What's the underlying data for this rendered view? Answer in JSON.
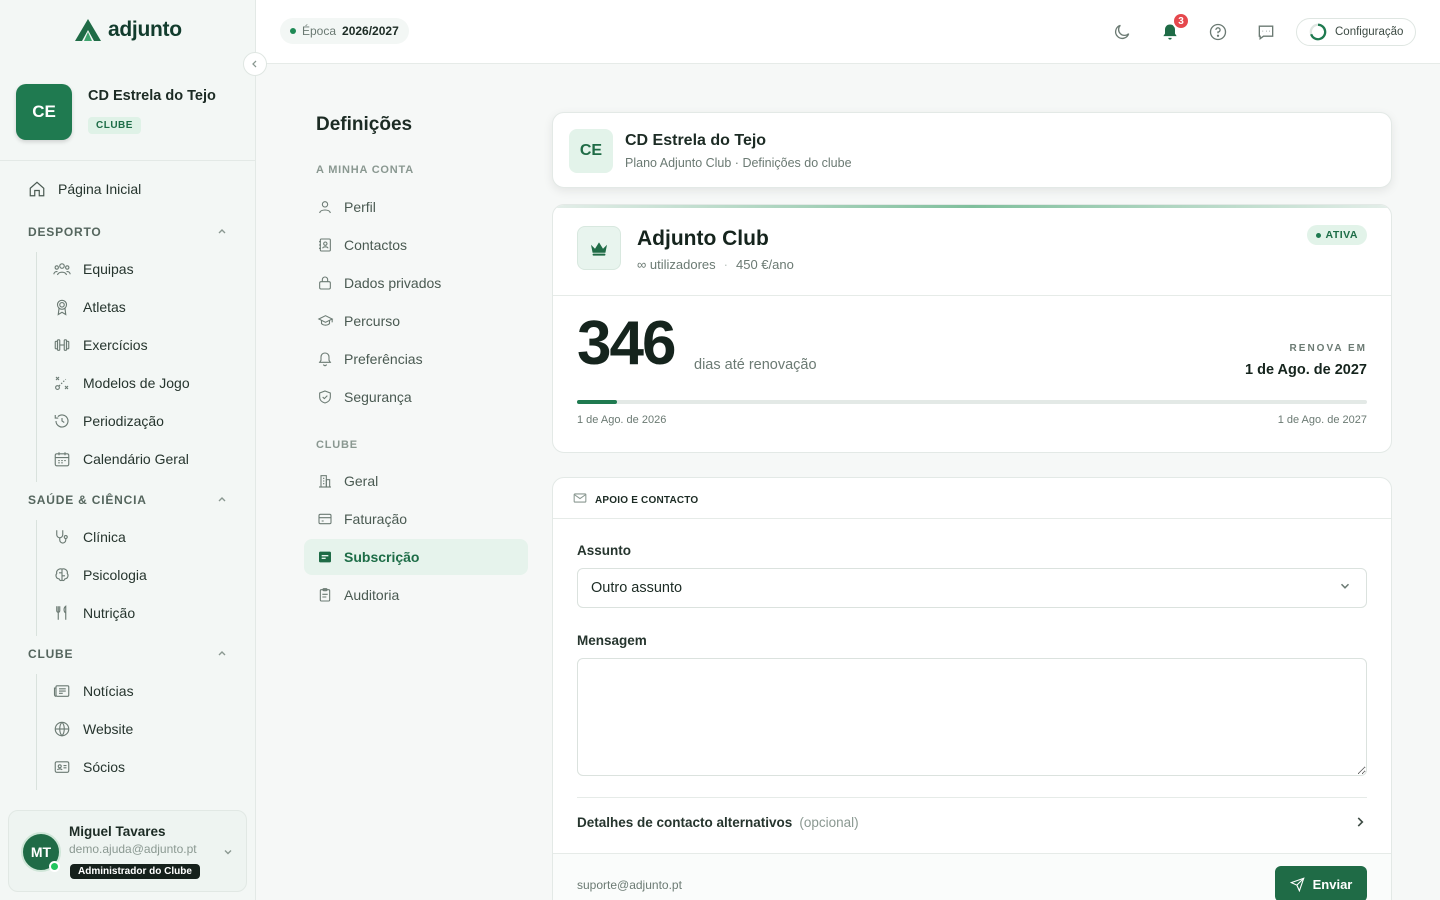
{
  "brand": {
    "name": "adjunto"
  },
  "club": {
    "initials": "CE",
    "name": "CD Estrela do Tejo",
    "tag": "CLUBE"
  },
  "sidebar": {
    "home": "Página Inicial",
    "sections": [
      {
        "title": "DESPORTO",
        "items": [
          "Equipas",
          "Atletas",
          "Exercícios",
          "Modelos de Jogo",
          "Periodização",
          "Calendário Geral"
        ]
      },
      {
        "title": "SAÚDE & CIÊNCIA",
        "items": [
          "Clínica",
          "Psicologia",
          "Nutrição"
        ]
      },
      {
        "title": "CLUBE",
        "items": [
          "Notícias",
          "Website",
          "Sócios"
        ]
      }
    ]
  },
  "user": {
    "initials": "MT",
    "name": "Miguel Tavares",
    "email": "demo.ajuda@adjunto.pt",
    "role": "Administrador do Clube"
  },
  "topbar": {
    "season_label": "Época",
    "season_value": "2026/2027",
    "notifications": "3",
    "config_label": "Configuração"
  },
  "settings": {
    "title": "Definições",
    "section_account": "A MINHA CONTA",
    "account_items": [
      "Perfil",
      "Contactos",
      "Dados privados",
      "Percurso",
      "Preferências",
      "Segurança"
    ],
    "section_club": "CLUBE",
    "club_items": [
      "Geral",
      "Faturação",
      "Subscrição",
      "Auditoria"
    ],
    "active": "Subscrição"
  },
  "club_header": {
    "initials": "CE",
    "name": "CD Estrela do Tejo",
    "subtitle": "Plano Adjunto Club · Definições do clube"
  },
  "plan": {
    "name": "Adjunto Club",
    "users": "∞ utilizadores",
    "price": "450 €/ano",
    "status": "ATIVA",
    "days": "346",
    "days_label": "dias até renovação",
    "renew_label": "RENOVA EM",
    "renew_date": "1 de Ago. de 2027",
    "start_date": "1 de Ago. de 2026",
    "end_date": "1 de Ago. de 2027",
    "progress_fraction": 0.05
  },
  "support": {
    "title": "APOIO E CONTACTO",
    "subject_label": "Assunto",
    "subject_value": "Outro assunto",
    "message_label": "Mensagem",
    "message_placeholder": "",
    "alt_contact_label": "Detalhes de contacto alternativos",
    "alt_contact_optional": "(opcional)",
    "email": "suporte@adjunto.pt",
    "send_label": "Enviar"
  },
  "colors": {
    "accent": "#1f6b46",
    "accent_light": "#e6f3ec",
    "danger": "#e5484d"
  }
}
